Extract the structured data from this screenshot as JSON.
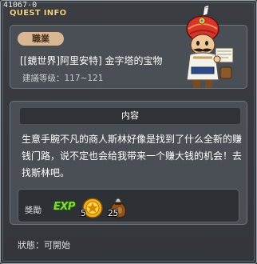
{
  "window": {
    "id_text": "41067-0",
    "title": "QUEST INFO"
  },
  "job": {
    "badge": "職業",
    "quest_name": "[[鏡世界]阿里安特] 金字塔的宝物",
    "level_label": "建議等级：",
    "level_range": "117~121"
  },
  "content": {
    "header": "内容",
    "description": "生意手腕不凡的商人斯林好像是找到了什么全新的赚钱门路，说不定也会给我带来一个赚大钱的机会！去找斯林吧。"
  },
  "reward": {
    "label": "獎勵",
    "exp_text": "EXP",
    "items": [
      {
        "icon": "gold-medal-icon",
        "quantity": "5"
      },
      {
        "icon": "money-bag-icon",
        "quantity": "25"
      }
    ]
  },
  "status": {
    "text": "狀態：可開始"
  },
  "colors": {
    "window_bg": "#383b40",
    "panel_bg": "#4a4f55",
    "badge_bg": "#d8b894",
    "title_gold": "#f2d58a",
    "exp_green": "#7edc36"
  }
}
